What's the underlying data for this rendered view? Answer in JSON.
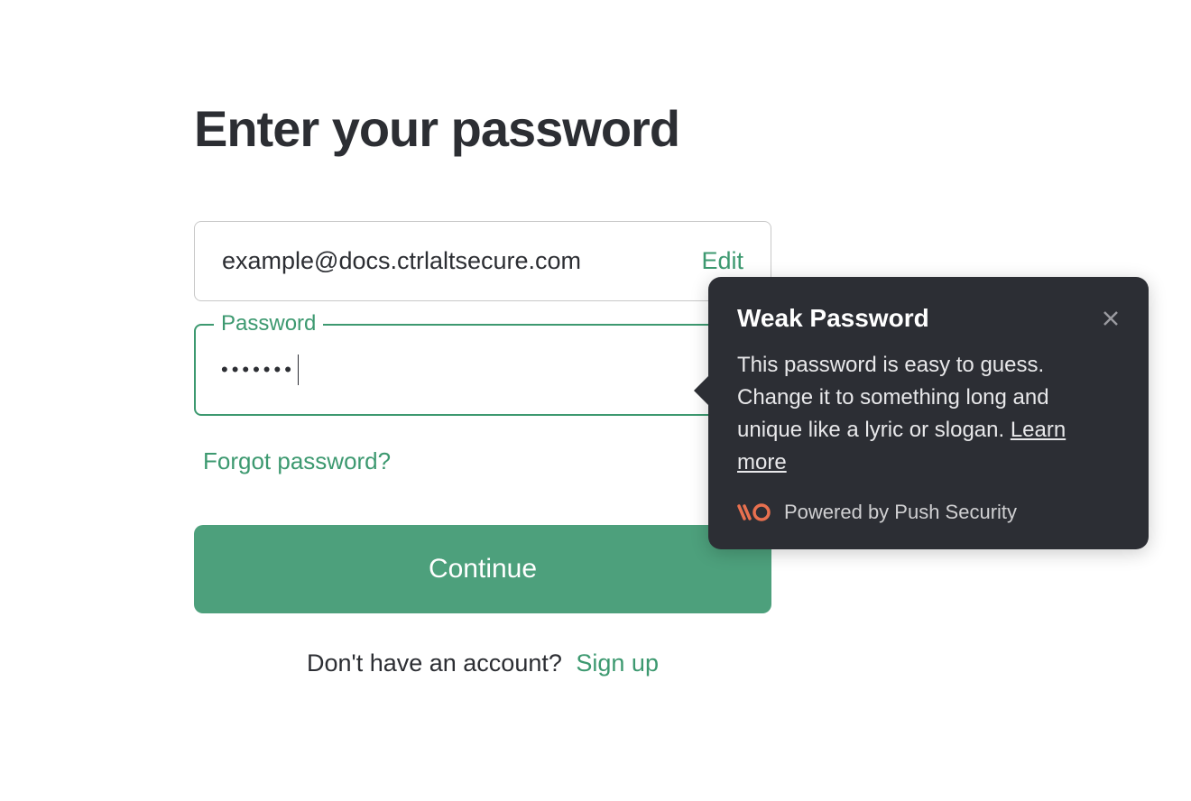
{
  "page": {
    "title": "Enter your password"
  },
  "email": {
    "value": "example@docs.ctrlaltsecure.com",
    "edit_label": "Edit"
  },
  "password": {
    "label": "Password",
    "dots": "•••••••"
  },
  "links": {
    "forgot": "Forgot password?",
    "continue": "Continue",
    "no_account": "Don't have an account?",
    "signup": "Sign up"
  },
  "tooltip": {
    "title": "Weak Password",
    "body": "This password is easy to guess. Change it to something long and unique like a lyric or slogan. ",
    "learn_more": "Learn more",
    "powered": "Powered by Push Security"
  }
}
